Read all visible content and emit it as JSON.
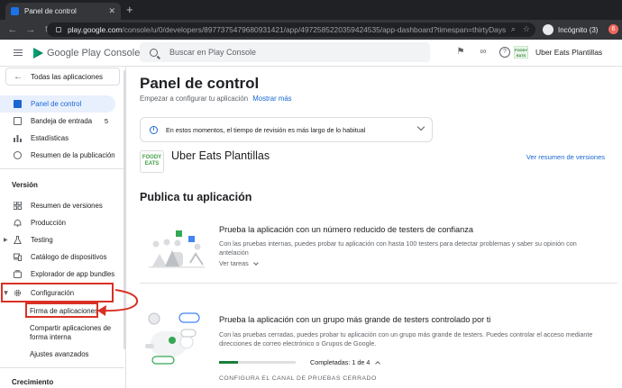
{
  "browser": {
    "tab_title": "Panel de control",
    "tab_close": "✕",
    "new_tab": "+",
    "url_host": "play.google.com",
    "url_path": "/console/u/0/developers/8977375479680931421/app/4972585220359424535/app-dashboard?timespan=thirtyDays",
    "incognito_label": "Incógnito (3)",
    "avatar_letter": "6"
  },
  "header": {
    "brand": "Google Play Console",
    "search_placeholder": "Buscar en Play Console",
    "app_name": "Uber Eats Plantillas",
    "app_thumb": "FOODY EATS"
  },
  "sidebar": {
    "all_apps": "Todas las aplicaciones",
    "items": [
      {
        "label": "Panel de control",
        "icon": "dashboard-icon"
      },
      {
        "label": "Bandeja de entrada",
        "count": "5",
        "icon": "inbox-icon"
      },
      {
        "label": "Estadísticas",
        "icon": "bar-chart-icon"
      },
      {
        "label": "Resumen de la publicación",
        "icon": "clock-icon"
      }
    ],
    "section_version": "Versión",
    "version_items": [
      {
        "label": "Resumen de versiones",
        "icon": "grid-icon"
      },
      {
        "label": "Producción",
        "icon": "bell-icon"
      },
      {
        "label": "Testing",
        "icon": "flask-icon"
      },
      {
        "label": "Catálogo de dispositivos",
        "icon": "devices-icon"
      },
      {
        "label": "Explorador de app bundles",
        "icon": "bundle-icon"
      },
      {
        "label": "Configuración",
        "icon": "gear-icon"
      }
    ],
    "config_sub": [
      {
        "label": "Firma de aplicaciones"
      },
      {
        "label": "Compartir aplicaciones de forma interna"
      },
      {
        "label": "Ajustes avanzados"
      }
    ],
    "section_growth": "Crecimiento"
  },
  "main": {
    "title": "Panel de control",
    "subtitle": "Empezar a configurar tu aplicación",
    "show_more": "Mostrar más",
    "banner": "En estos momentos, el tiempo de revisión es más largo de lo habitual",
    "app_name": "Uber Eats Plantillas",
    "app_thumb": "FOODY EATS",
    "view_versions": "Ver resumen de versiones",
    "publish_title": "Publica tu aplicación",
    "cards": [
      {
        "title": "Prueba la aplicación con un número reducido de testers de confianza",
        "desc": "Con las pruebas internas, puedes probar tu aplicación con hasta 100 testers para detectar problemas y saber su opinión con antelación",
        "link": "Ver tareas"
      },
      {
        "title": "Prueba la aplicación con un grupo más grande de testers controlado por ti",
        "desc": "Con las pruebas cerradas, puedes probar tu aplicación con un grupo más grande de testers. Puedes controlar el acceso mediante direcciones de correo electrónico o Grupos de Google.",
        "progress_label": "Completadas: 1 de 4",
        "progress": 0.25,
        "step": "CONFIGURA EL CANAL DE PRUEBAS CERRADO"
      }
    ]
  },
  "colors": {
    "accent": "#1967d2",
    "active_bg": "#e8f0fe",
    "highlight": "#d93025",
    "progress": "#188038"
  }
}
